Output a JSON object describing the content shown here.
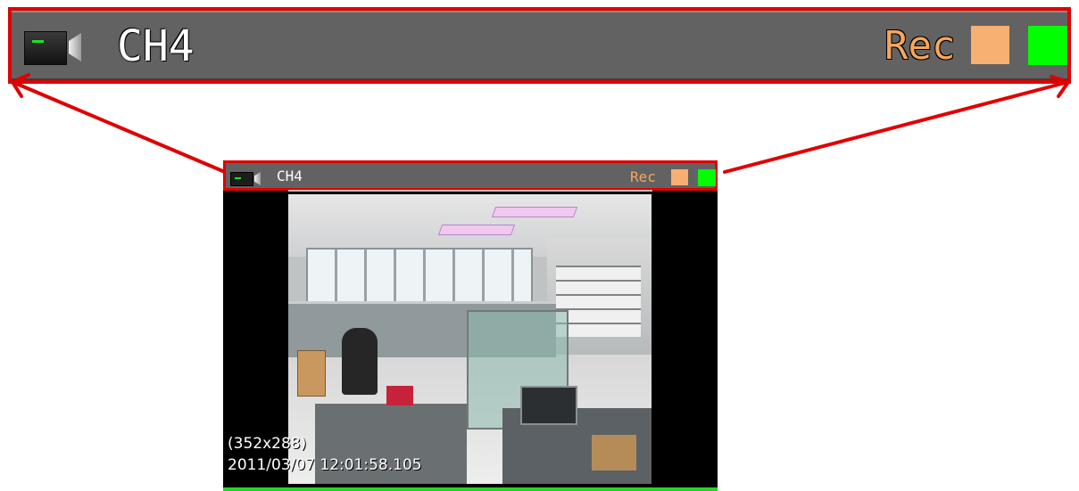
{
  "zoomed_bar": {
    "channel_label": "CH4",
    "rec_label": "Rec",
    "indicator_colors": [
      "#f8b072",
      "#00ff00"
    ]
  },
  "viewer": {
    "title_bar": {
      "channel_label": "CH4",
      "rec_label": "Rec",
      "indicator_colors": [
        "#f8b072",
        "#00ff00"
      ]
    },
    "video_overlay": {
      "resolution": "(352x288)",
      "timestamp": "2011/03/07 12:01:58.105"
    },
    "progress": 1.0
  },
  "colors": {
    "highlight": "#e00000",
    "titlebar_bg": "#626262",
    "rec_text": "#f7a55d",
    "progress": "#25d427"
  }
}
